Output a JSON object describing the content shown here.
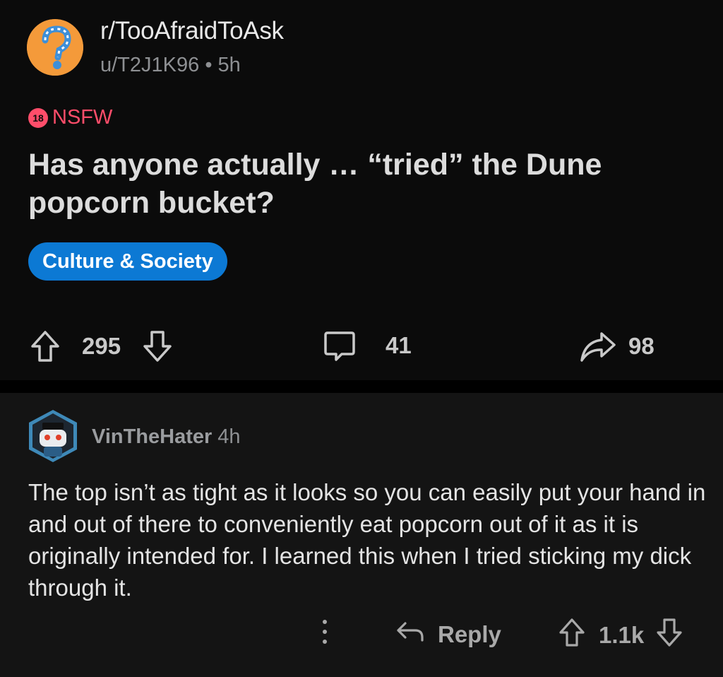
{
  "post": {
    "subreddit": "r/TooAfraidToAsk",
    "author": "u/T2J1K96",
    "age": "5h",
    "nsfw_badge": "18",
    "nsfw_label": "NSFW",
    "title": "Has anyone actually … “tried” the Dune popcorn bucket?",
    "flair": "Culture & Society",
    "upvotes": "295",
    "comments": "41",
    "shares": "98"
  },
  "comment": {
    "username": "VinTheHater",
    "age": "4h",
    "body": "The top isn’t as tight as it looks so you can easily put your hand in and out of there to conveniently eat popcorn out of it as it is originally intended for. I learned this when I tried sticking my dick through it.",
    "reply_label": "Reply",
    "score": "1.1k"
  },
  "colors": {
    "background": "#0b0b0b",
    "nsfw": "#ff4d6a",
    "flair": "#0c79d4",
    "subreddit_icon": "#f49a3a"
  }
}
